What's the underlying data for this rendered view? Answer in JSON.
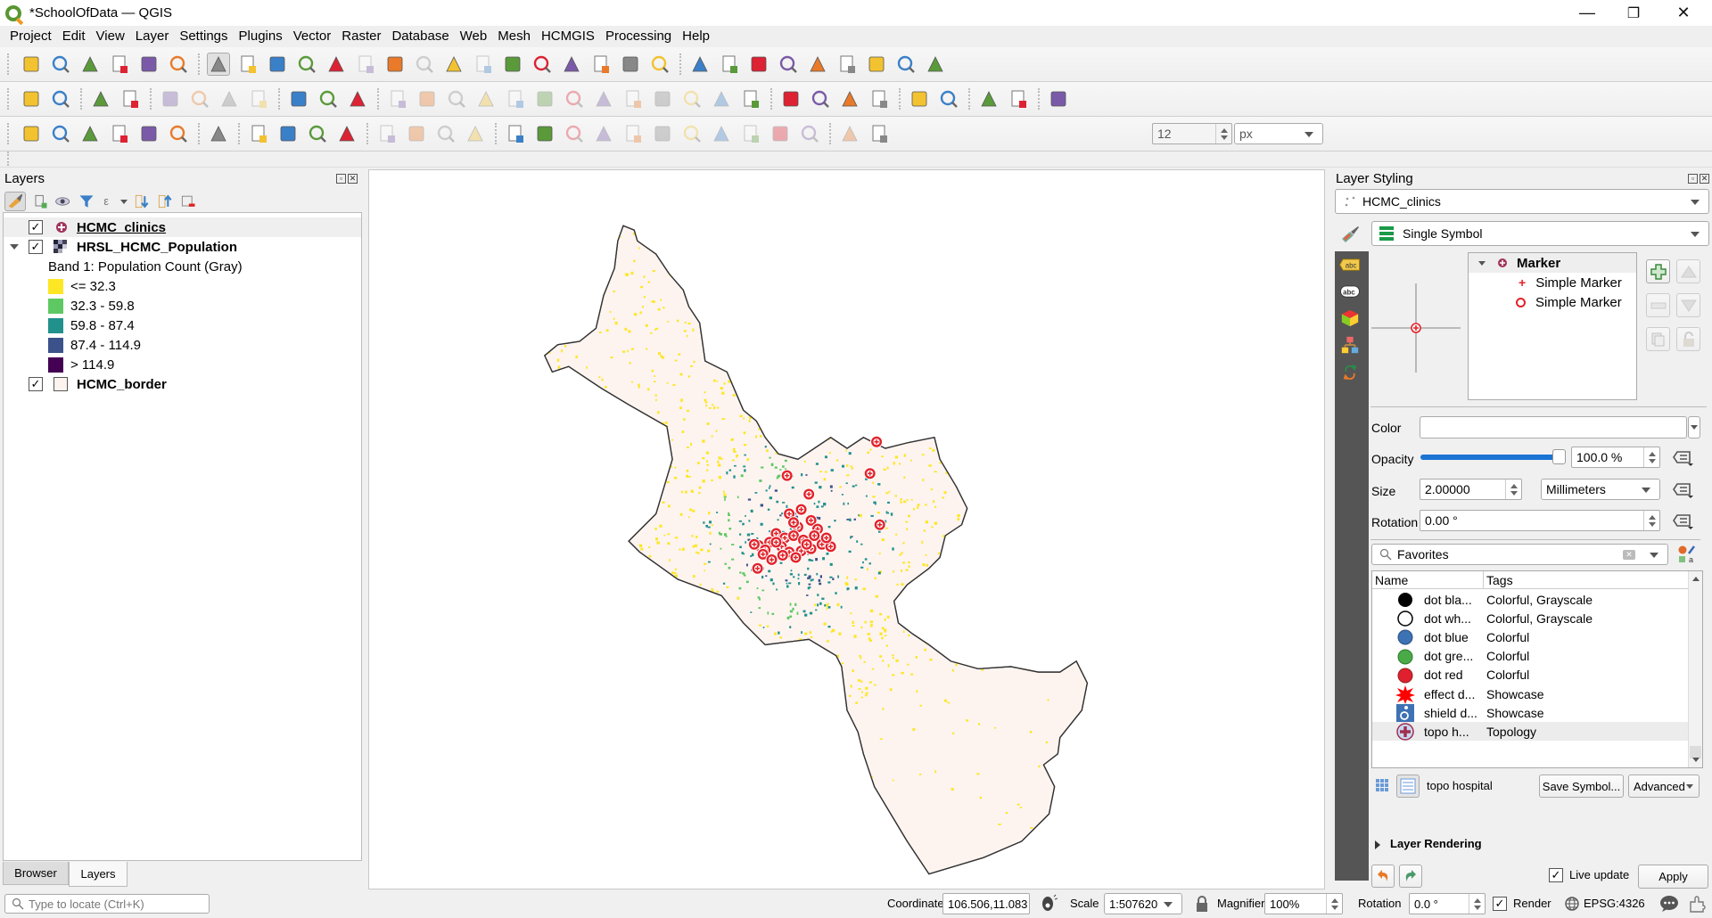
{
  "window": {
    "title": "*SchoolOfData — QGIS",
    "controls": {
      "minimize": "—",
      "restore": "❐",
      "close": "✕"
    }
  },
  "menu": [
    "Project",
    "Edit",
    "View",
    "Layer",
    "Settings",
    "Plugins",
    "Vector",
    "Raster",
    "Database",
    "Web",
    "Mesh",
    "HCMGIS",
    "Processing",
    "Help"
  ],
  "toolbars": {
    "row1_icons": [
      "new-project",
      "open-project",
      "save-project",
      "new-print-layout",
      "layout-manager",
      "style-manager",
      "pan",
      "pan-to-selection",
      "zoom-in",
      "zoom-out",
      "zoom-full",
      "zoom-to-selection",
      "zoom-to-layer",
      "zoom-native",
      "zoom-last",
      "zoom-next",
      "new-spatial-bookmark",
      "show-bookmarks",
      "new-3d-map",
      "new-map-view",
      "temporal-controller",
      "refresh",
      "identify",
      "attribute-table",
      "field-calculator-stats",
      "processing-toolbox",
      "statistical-summary",
      "measure",
      "map-tips",
      "actions",
      "annotations"
    ],
    "row2_icons": [
      "label-layer",
      "diagram",
      "pin-labels",
      "highlight-pinned",
      "show-hide-labels",
      "move-label",
      "rotate-label",
      "change-label",
      "toggle-editing-tool",
      "georeferencer",
      "triangle-tool",
      "digitize-curve",
      "add-ring",
      "rotate-feature",
      "simplify",
      "offset",
      "reshape",
      "split",
      "merge",
      "delete-ring",
      "delete-part",
      "fill-ring",
      "vertex-tool",
      "more",
      "python-console",
      "qfieldsync",
      "dev-tools",
      "undo-plugin",
      "globe",
      "profile",
      "search",
      "quickmapservices",
      "dataplotly"
    ],
    "row3_icons": [
      "add-layer",
      "add-wms",
      "add-vector",
      "digitize",
      "add-delimited",
      "add-virtual",
      "help",
      "select-features",
      "select-by-attribute",
      "deselect",
      "select-by-location",
      "add-circle",
      "add-ellipse",
      "add-rectangle",
      "add-polygon",
      "toggle-edits",
      "edit-pencil",
      "save-edits",
      "add-point",
      "vertex-editor",
      "modify-attr",
      "delete-selected",
      "cut",
      "copy",
      "paste",
      "undo",
      "redo",
      "snapping-magnet",
      "snap-type",
      "snap-mode"
    ],
    "snap_tolerance": "12",
    "snap_units": "px"
  },
  "layers_panel": {
    "title": "Layers",
    "layers": [
      {
        "name": "HCMC_clinics",
        "checked": true,
        "selected": true
      },
      {
        "name": "HRSL_HCMC_Population",
        "checked": true,
        "expanded": true
      },
      {
        "name": "HCMC_border",
        "checked": true
      }
    ],
    "band_label": "Band 1: Population Count (Gray)",
    "legend": [
      {
        "label": "<= 32.3",
        "color": "#fde725"
      },
      {
        "label": "32.3 - 59.8",
        "color": "#5ec962"
      },
      {
        "label": "59.8 - 87.4",
        "color": "#21918c"
      },
      {
        "label": "87.4 - 114.9",
        "color": "#3b528b"
      },
      {
        "label": "> 114.9",
        "color": "#440154"
      }
    ],
    "border_fill": "#fdf4f0",
    "tabs": [
      "Browser",
      "Layers"
    ],
    "active_tab": "Layers"
  },
  "locator": {
    "placeholder": "Type to locate (Ctrl+K)"
  },
  "styling_panel": {
    "title": "Layer Styling",
    "layer": "HCMC_clinics",
    "renderer": "Single Symbol",
    "symbol_tree": {
      "root": "Marker",
      "children": [
        "Simple Marker",
        "Simple Marker"
      ]
    },
    "color_label": "Color",
    "color_value": "",
    "opacity_label": "Opacity",
    "opacity_value": "100.0 %",
    "opacity_fraction": 1.0,
    "size_label": "Size",
    "size_value": "2.00000",
    "size_units": "Millimeters",
    "rotation_label": "Rotation",
    "rotation_value": "0.00 °",
    "search_value": "Favorites",
    "columns": [
      "Name",
      "Tags"
    ],
    "symbols": [
      {
        "name": "dot  bla...",
        "tags": "Colorful, Grayscale",
        "icon": "black-dot"
      },
      {
        "name": "dot  wh...",
        "tags": "Colorful, Grayscale",
        "icon": "white-dot"
      },
      {
        "name": "dot blue",
        "tags": "Colorful",
        "icon": "blue-dot"
      },
      {
        "name": "dot gre...",
        "tags": "Colorful",
        "icon": "green-dot"
      },
      {
        "name": "dot red",
        "tags": "Colorful",
        "icon": "red-dot"
      },
      {
        "name": "effect d...",
        "tags": "Showcase",
        "icon": "red-star"
      },
      {
        "name": "shield d...",
        "tags": "Showcase",
        "icon": "wheelchair-shield"
      },
      {
        "name": "topo h...",
        "tags": "Topology",
        "icon": "hospital-cross",
        "selected": true
      }
    ],
    "selected_symbol_name": "topo hospital",
    "save_symbol_label": "Save Symbol...",
    "advanced_label": "Advanced",
    "layer_rendering_label": "Layer Rendering",
    "live_update_label": "Live update",
    "live_update": true,
    "apply_label": "Apply"
  },
  "statusbar": {
    "coordinate_label": "Coordinate",
    "coordinate_value": "106.506,11.083",
    "scale_label": "Scale",
    "scale_value": "1:507620",
    "magnifier_label": "Magnifier",
    "magnifier_value": "100%",
    "rotation_label": "Rotation",
    "rotation_value": "0.0 °",
    "render_label": "Render",
    "render_checked": true,
    "crs": "EPSG:4326"
  },
  "map": {
    "clinic_color": "#e3222a",
    "clinic_count_visible": 34
  }
}
